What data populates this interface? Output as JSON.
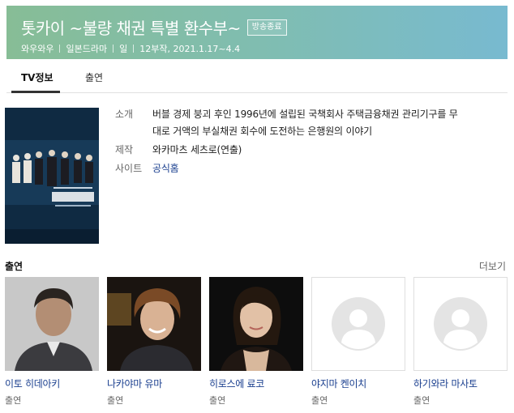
{
  "header": {
    "title": "톳카이 ~불량 채권 특별 환수부~",
    "badge": "방송종료",
    "meta": [
      "와우와우",
      "일본드라마",
      "일",
      "12부작, 2021.1.17~4.4"
    ]
  },
  "tabs": [
    {
      "label": "TV정보",
      "active": true
    },
    {
      "label": "출연",
      "active": false
    }
  ],
  "info": {
    "synopsis_label": "소개",
    "synopsis_line1": "버블 경제 붕괴 후인 1996년에 설립된 국책회사 주택금융채권 관리기구를 무",
    "synopsis_line2": "대로 거액의 부실채권 회수에 도전하는 은행원의 이야기",
    "producer_label": "제작",
    "producer_value": "와카마츠 세츠로(연출)",
    "site_label": "사이트",
    "site_value": "공식홈"
  },
  "cast_section": {
    "title": "출연",
    "more_label": "더보기",
    "members": [
      {
        "name": "이토 히데아키",
        "role": "출연",
        "photo": "actor-photo"
      },
      {
        "name": "나카야마 유마",
        "role": "출연",
        "photo": "actor-photo"
      },
      {
        "name": "히로스에 료코",
        "role": "출연",
        "photo": "actor-photo"
      },
      {
        "name": "야지마 켄이치",
        "role": "출연",
        "photo": "person-placeholder-icon"
      },
      {
        "name": "하기와라 마사토",
        "role": "출연",
        "photo": "person-placeholder-icon"
      }
    ]
  },
  "colors": {
    "header_gradient_start": "#87bd96",
    "header_gradient_end": "#78bad0",
    "link": "#1a3f8f",
    "poster_bg": "#10283f"
  }
}
